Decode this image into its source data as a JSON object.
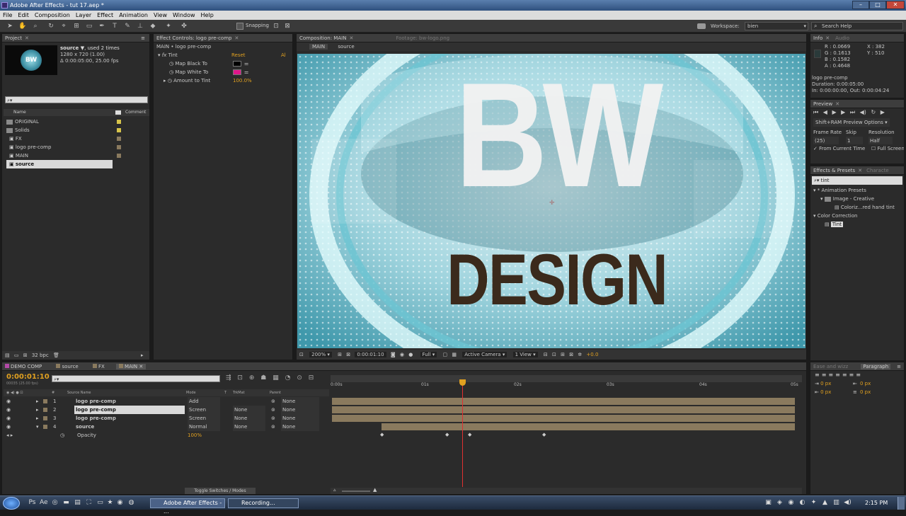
{
  "window": {
    "title": "Adobe After Effects - tut 17.aep *"
  },
  "menu": [
    "File",
    "Edit",
    "Composition",
    "Layer",
    "Effect",
    "Animation",
    "View",
    "Window",
    "Help"
  ],
  "toolbar": {
    "snapping": "Snapping",
    "workspace_label": "Workspace:",
    "workspace_value": "bien",
    "search_help": "Search Help"
  },
  "project": {
    "tab": "Project",
    "item_name": "source ▼",
    "used": ", used 2 times",
    "dims": "1280 x 720 (1.00)",
    "duration": "Δ 0:00:05:00, 25.00 fps",
    "thumb_text": "BW",
    "search_placeholder": "",
    "col_name": "Name",
    "col_comment": "Comment",
    "items": [
      "ORIGINAL",
      "Solids",
      "FX",
      "logo pre-comp",
      "MAIN",
      "source"
    ],
    "bpc": "32 bpc"
  },
  "effect_controls": {
    "tab": "Effect Controls: logo pre-comp",
    "path": "MAIN • logo pre-comp",
    "effect": "Tint",
    "reset": "Reset",
    "about": "Al",
    "props": [
      {
        "label": "Map Black To",
        "color": "#000000"
      },
      {
        "label": "Map White To",
        "color": "#e0168a"
      },
      {
        "label": "Amount to Tint",
        "value": "100.0%"
      }
    ]
  },
  "composition": {
    "tab": "Composition: MAIN",
    "footage_tab": "Footage: bw-logo.png",
    "crumbs": [
      "MAIN",
      "source"
    ],
    "logo_top": "BW",
    "logo_bottom": "DESIGN",
    "zoom": "200%",
    "time": "0:00:01:10",
    "resolution": "Full",
    "camera": "Active Camera",
    "views": "1 View",
    "exposure": "+0.0"
  },
  "info": {
    "tab": "Info",
    "audio_tab": "Audio",
    "r": "R : 0.0669",
    "g": "G : 0.1613",
    "b": "B : 0.1582",
    "a": "A : 0.4648",
    "x": "X : 382",
    "y": "Y : 510",
    "layer": "logo pre-comp",
    "duration": "Duration: 0:00:05:00",
    "inout": "In: 0:00:00:00, Out: 0:00:04:24"
  },
  "preview": {
    "tab": "Preview",
    "options": "Shift+RAM Preview Options",
    "frame_rate_label": "Frame Rate",
    "skip_label": "Skip",
    "resolution_label": "Resolution",
    "frame_rate": "(25)",
    "skip": "1",
    "resolution": "Half",
    "from_current": "From Current Time",
    "full_screen": "Full Screen"
  },
  "effects_presets": {
    "tab": "Effects & Presets",
    "tab2": "Characte",
    "search": "tint",
    "tree": [
      "* Animation Presets",
      "Image - Creative",
      "Coloriz...red hand tint",
      "Color Correction",
      "Tint"
    ]
  },
  "timeline": {
    "tabs": [
      "DEMO COMP",
      "source",
      "FX",
      "MAIN"
    ],
    "timecode": "0:00:01:10",
    "frames": "00035 (25.00 fps)",
    "headers": {
      "source_name": "Source Name",
      "mode": "Mode",
      "t": "T",
      "trkmat": "TrkMat",
      "parent": "Parent"
    },
    "layers": [
      {
        "num": "1",
        "name": "logo pre-comp",
        "mode": "Add",
        "trkmat": "",
        "parent": "None"
      },
      {
        "num": "2",
        "name": "logo pre-comp",
        "mode": "Screen",
        "trkmat": "None",
        "parent": "None"
      },
      {
        "num": "3",
        "name": "logo pre-comp",
        "mode": "Screen",
        "trkmat": "None",
        "parent": "None"
      },
      {
        "num": "4",
        "name": "source",
        "mode": "Normal",
        "trkmat": "None",
        "parent": "None"
      }
    ],
    "opacity_label": "Opacity",
    "opacity_value": "100%",
    "ruler": [
      "0:00s",
      "01s",
      "02s",
      "03s",
      "04s",
      "05s"
    ],
    "toggle": "Toggle Switches / Modes"
  },
  "paragraph": {
    "tab1": "Ease and wizz",
    "tab2": "Paragraph",
    "px": [
      "0 px",
      "0 px",
      "0 px",
      "0 px",
      "0 px"
    ]
  },
  "taskbar": {
    "ae_task": "Adobe After Effects - ...",
    "rec_task": "Recording...",
    "clock": "2:15 PM"
  },
  "colors": {
    "accent": "#e0a020",
    "playhead": "#e03030",
    "label_yellow": "#d6c34a"
  }
}
